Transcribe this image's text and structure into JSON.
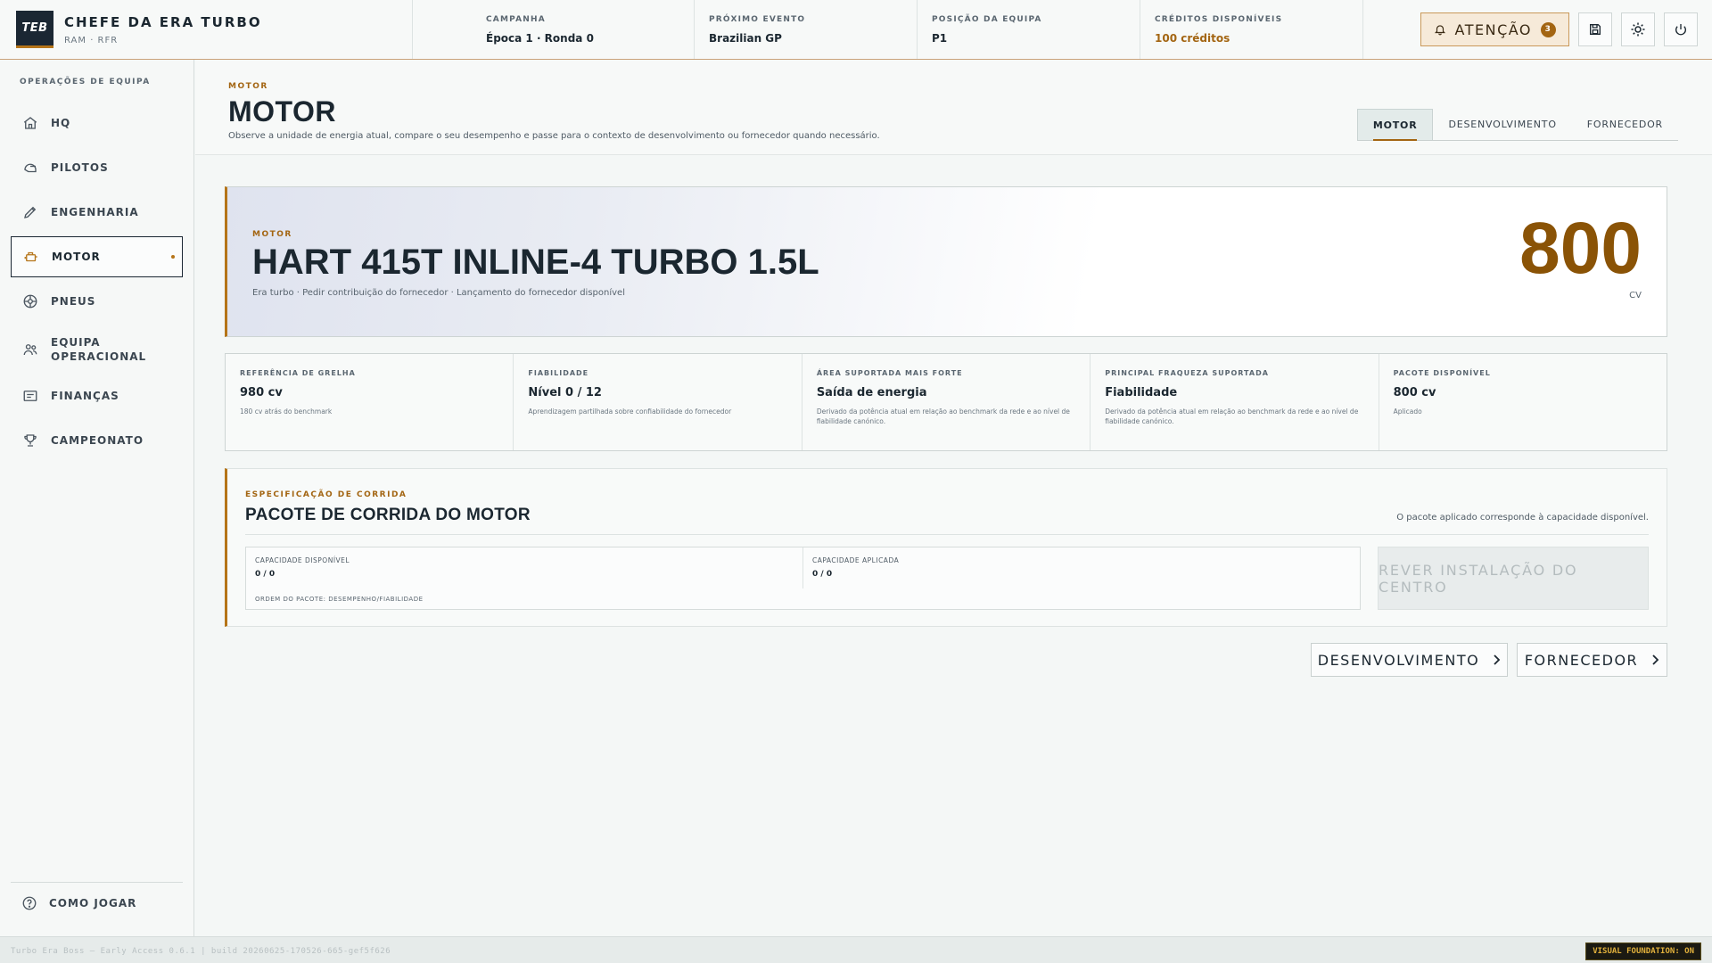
{
  "header": {
    "logo_text": "TEB",
    "title": "CHEFE DA ERA TURBO",
    "subtitle": "RAM · RFR",
    "stats": [
      {
        "label": "CAMPANHA",
        "value": "Época 1 · Ronda 0"
      },
      {
        "label": "PRÓXIMO EVENTO",
        "value": "Brazilian GP"
      },
      {
        "label": "POSIÇÃO DA EQUIPA",
        "value": "P1"
      },
      {
        "label": "CRÉDITOS DISPONÍVEIS",
        "value": "100 créditos"
      }
    ],
    "attention_label": "ATENÇÃO",
    "attention_count": "3"
  },
  "sidebar": {
    "heading": "OPERAÇÕES DE EQUIPA",
    "items": [
      {
        "label": "HQ",
        "icon": "home-icon"
      },
      {
        "label": "PILOTOS",
        "icon": "helmet-icon"
      },
      {
        "label": "ENGENHARIA",
        "icon": "pencil-icon"
      },
      {
        "label": "MOTOR",
        "icon": "engine-icon",
        "active": true
      },
      {
        "label": "PNEUS",
        "icon": "tire-icon"
      },
      {
        "label": "EQUIPA\nOPERACIONAL",
        "label_line1": "EQUIPA",
        "label_line2": "OPERACIONAL",
        "icon": "people-icon"
      },
      {
        "label": "FINANÇAS",
        "icon": "finance-icon"
      },
      {
        "label": "CAMPEONATO",
        "icon": "trophy-icon"
      }
    ],
    "footer_label": "COMO JOGAR"
  },
  "page": {
    "eyebrow": "MOTOR",
    "title": "MOTOR",
    "description": "Observe a unidade de energia atual, compare o seu desempenho e passe para o contexto de desenvolvimento ou fornecedor quando necessário.",
    "tabs": [
      {
        "label": "MOTOR",
        "active": true
      },
      {
        "label": "DESENVOLVIMENTO"
      },
      {
        "label": "FORNECEDOR"
      }
    ]
  },
  "hero": {
    "eyebrow": "MOTOR",
    "title": "HART 415T INLINE-4 TURBO 1.5L",
    "subtitle": "Era turbo · Pedir contribuição do fornecedor · Lançamento do fornecedor disponível",
    "power": "800",
    "unit": "CV"
  },
  "stats_grid": [
    {
      "label": "REFERÊNCIA DE GRELHA",
      "value": "980 cv",
      "note": "180 cv atrás do benchmark"
    },
    {
      "label": "FIABILIDADE",
      "value": "Nível 0 / 12",
      "note": "Aprendizagem partilhada sobre confiabilidade do fornecedor"
    },
    {
      "label": "ÁREA SUPORTADA MAIS FORTE",
      "value": "Saída de energia",
      "note": "Derivado da potência atual em relação ao benchmark da rede e ao nível de fiabilidade canónico."
    },
    {
      "label": "PRINCIPAL FRAQUEZA SUPORTADA",
      "value": "Fiabilidade",
      "note": "Derivado da potência atual em relação ao benchmark da rede e ao nível de fiabilidade canónico."
    },
    {
      "label": "PACOTE DISPONÍVEL",
      "value": "800 cv",
      "note": "Aplicado"
    }
  ],
  "spec": {
    "eyebrow": "ESPECIFICAÇÃO DE CORRIDA",
    "title": "PACOTE DE CORRIDA DO MOTOR",
    "note": "O pacote aplicado corresponde à capacidade disponível.",
    "available_label": "CAPACIDADE DISPONÍVEL",
    "available_value": "0 / 0",
    "applied_label": "CAPACIDADE APLICADA",
    "applied_value": "0 / 0",
    "order_label": "ORDEM DO PACOTE: DESEMPENHO/FIABILIDADE",
    "review_button": "REVER INSTALAÇÃO DO CENTRO"
  },
  "nav_buttons": {
    "development": "DESENVOLVIMENTO",
    "supplier": "FORNECEDOR"
  },
  "footer": {
    "build": "Turbo Era Boss — Early Access 0.6.1 | build 20260625-170526-665-gef5f626",
    "visual_foundation": "VISUAL FOUNDATION: ON"
  }
}
